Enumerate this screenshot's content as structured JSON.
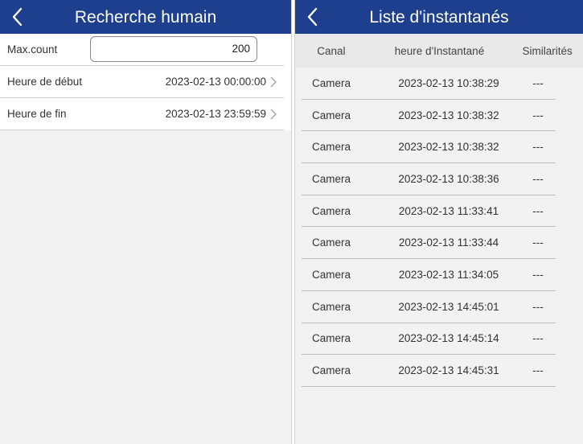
{
  "left": {
    "title": "Recherche humain",
    "max_count": {
      "label": "Max.count",
      "value": "200"
    },
    "start_time": {
      "label": "Heure de début",
      "value": "2023-02-13 00:00:00"
    },
    "end_time": {
      "label": "Heure de fin",
      "value": "2023-02-13 23:59:59"
    }
  },
  "right": {
    "title": "Liste d'instantanés",
    "columns": [
      "Canal",
      "heure d'Instantané",
      "Similarités"
    ],
    "rows": [
      {
        "channel": "Camera",
        "time": "2023-02-13 10:38:29",
        "similarity": "---"
      },
      {
        "channel": "Camera",
        "time": "2023-02-13 10:38:32",
        "similarity": "---"
      },
      {
        "channel": "Camera",
        "time": "2023-02-13 10:38:32",
        "similarity": "---"
      },
      {
        "channel": "Camera",
        "time": "2023-02-13 10:38:36",
        "similarity": "---"
      },
      {
        "channel": "Camera",
        "time": "2023-02-13 11:33:41",
        "similarity": "---"
      },
      {
        "channel": "Camera",
        "time": "2023-02-13 11:33:44",
        "similarity": "---"
      },
      {
        "channel": "Camera",
        "time": "2023-02-13 11:34:05",
        "similarity": "---"
      },
      {
        "channel": "Camera",
        "time": "2023-02-13 14:45:01",
        "similarity": "---"
      },
      {
        "channel": "Camera",
        "time": "2023-02-13 14:45:14",
        "similarity": "---"
      },
      {
        "channel": "Camera",
        "time": "2023-02-13 14:45:31",
        "similarity": "---"
      }
    ]
  },
  "colors": {
    "header_bg": "#1d3f8e",
    "header_text": "#ffffff",
    "page_bg": "#f2f2f2"
  },
  "icons": {
    "back": "chevron-left-icon",
    "row_arrow": "chevron-right-icon"
  }
}
